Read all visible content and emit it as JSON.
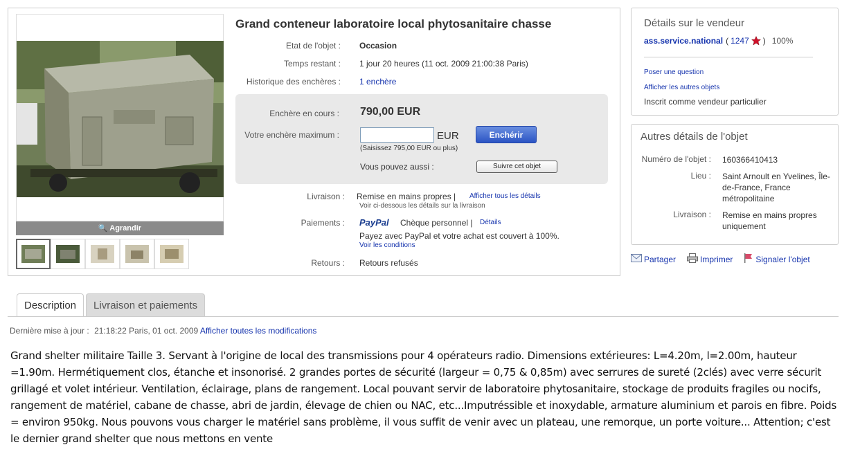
{
  "listing": {
    "title": "Grand conteneur laboratoire local phytosanitaire chasse",
    "enlarge_label": "Agrandir",
    "condition_label": "Etat de l'objet :",
    "condition_value": "Occasion",
    "time_left_label": "Temps restant :",
    "time_left_value": "1 jour 20 heures (11 oct. 2009  21:00:38 Paris)",
    "history_label": "Historique des enchères :",
    "history_value": "1 enchère",
    "current_bid_label": "Enchère en cours :",
    "current_bid_value": "790,00 EUR",
    "max_bid_label": "Votre enchère maximum :",
    "max_bid_input_value": "",
    "currency": "EUR",
    "bid_button": "Enchérir",
    "bid_hint": "(Saisissez 795,00 EUR ou plus)",
    "also_label": "Vous pouvez aussi :",
    "follow_button": "Suivre cet objet",
    "delivery_label": "Livraison :",
    "delivery_value": "Remise en mains propres |",
    "delivery_link": "Afficher tous les détails",
    "delivery_note": "Voir ci-dessous les détails sur la livraison",
    "payment_label": "Paiements :",
    "paypal_logo": "PayPal",
    "payment_value": "Chèque personnel |",
    "payment_link": "Détails",
    "paypal_note": "Payez avec PayPal et votre achat est couvert à 100%.",
    "conditions_link": "Voir les conditions",
    "returns_label": "Retours :",
    "returns_value": "Retours refusés"
  },
  "seller": {
    "title": "Détails sur le vendeur",
    "name": "ass.service.national",
    "open_paren": "(",
    "feedback": "1247",
    "close_paren": ")",
    "positive": "100%",
    "ask_question": "Poser une question",
    "other_items": "Afficher les autres objets",
    "registered": "Inscrit comme vendeur particulier"
  },
  "item_details": {
    "title": "Autres détails de l'objet",
    "number_label": "Numéro de l'objet :",
    "number_value": "160366410413",
    "location_label": "Lieu :",
    "location_value": "Saint Arnoult en Yvelines, Île-de-France, France métropolitaine",
    "delivery_label": "Livraison :",
    "delivery_value": "Remise en mains propres uniquement"
  },
  "actions": {
    "share": "Partager",
    "print": "Imprimer",
    "report": "Signaler l'objet"
  },
  "tabs": {
    "description": "Description",
    "shipping": "Livraison et paiements"
  },
  "updated": {
    "label": "Dernière mise à jour :",
    "value": "21:18:22 Paris, 01 oct. 2009",
    "link": "Afficher toutes les modifications"
  },
  "description": "Grand shelter militaire Taille 3. Servant à l'origine de local des transmissions pour 4 opérateurs radio. Dimensions extérieures: L=4.20m, l=2.00m, hauteur =1.90m. Hermétiquement clos, étanche et insonorisé. 2 grandes portes de sécurité (largeur = 0,75 & 0,85m) avec serrures de sureté (2clés) avec verre sécurit grillagé et volet intérieur. Ventilation, éclairage, plans de rangement. Local pouvant servir de laboratoire phytosanitaire, stockage de produits fragiles ou nocifs, rangement de matériel, cabane de chasse, abri de jardin, élevage de chien ou NAC, etc...Imputréssible et inoxydable, armature aluminium et parois en fibre. Poids = environ 950kg. Nous pouvons vous charger le matériel sans problème, il vous suffit de venir avec un plateau, une remorque, un porte voiture... Attention; c'est le dernier grand shelter que nous mettons en vente",
  "colors": {
    "link": "#1533ad",
    "bid_button": "#2b54c4",
    "panel": "#e9e9e9",
    "star": "#d0102a"
  }
}
